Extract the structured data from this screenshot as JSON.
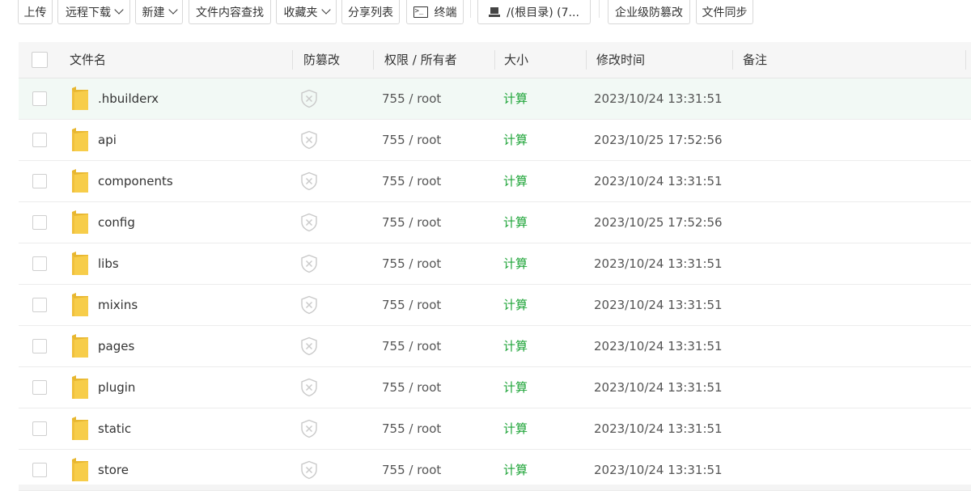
{
  "toolbar": {
    "upload": "上传",
    "remote_download": "远程下载",
    "new": "新建",
    "content_search": "文件内容查找",
    "favorites": "收藏夹",
    "share_list": "分享列表",
    "terminal": "终端",
    "terminal_glyph": ">_",
    "disk": "/(根目录) (7...",
    "enterprise_tamper": "企业级防篡改",
    "file_sync": "文件同步"
  },
  "table": {
    "headers": {
      "name": "文件名",
      "tamper": "防篡改",
      "perm": "权限 / 所有者",
      "size": "大小",
      "mtime": "修改时间",
      "note": "备注"
    },
    "rows": [
      {
        "name": ".hbuilderx",
        "perm": "755 / root",
        "size": "计算",
        "mtime": "2023/10/24 13:31:51"
      },
      {
        "name": "api",
        "perm": "755 / root",
        "size": "计算",
        "mtime": "2023/10/25 17:52:56"
      },
      {
        "name": "components",
        "perm": "755 / root",
        "size": "计算",
        "mtime": "2023/10/24 13:31:51"
      },
      {
        "name": "config",
        "perm": "755 / root",
        "size": "计算",
        "mtime": "2023/10/25 17:52:56"
      },
      {
        "name": "libs",
        "perm": "755 / root",
        "size": "计算",
        "mtime": "2023/10/24 13:31:51"
      },
      {
        "name": "mixins",
        "perm": "755 / root",
        "size": "计算",
        "mtime": "2023/10/24 13:31:51"
      },
      {
        "name": "pages",
        "perm": "755 / root",
        "size": "计算",
        "mtime": "2023/10/24 13:31:51"
      },
      {
        "name": "plugin",
        "perm": "755 / root",
        "size": "计算",
        "mtime": "2023/10/24 13:31:51"
      },
      {
        "name": "static",
        "perm": "755 / root",
        "size": "计算",
        "mtime": "2023/10/24 13:31:51"
      },
      {
        "name": "store",
        "perm": "755 / root",
        "size": "计算",
        "mtime": "2023/10/24 13:31:51"
      }
    ]
  },
  "colors": {
    "accent_green": "#20a53a",
    "folder_yellow": "#f7cd4a",
    "highlight_row": "#f2f9f5"
  }
}
